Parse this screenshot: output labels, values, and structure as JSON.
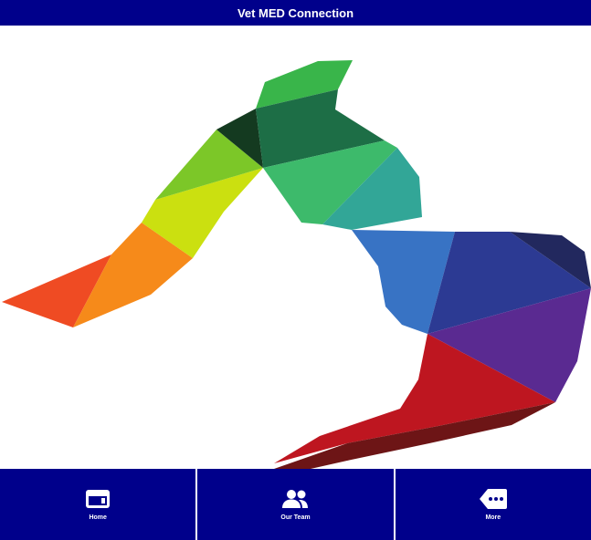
{
  "header": {
    "title": "Vet MED Connection"
  },
  "artwork": {
    "icon": "polygon-animal-silhouette"
  },
  "tabs": [
    {
      "label": "Home",
      "icon": "home-card-icon"
    },
    {
      "label": "Our Team",
      "icon": "people-icon"
    },
    {
      "label": "More",
      "icon": "more-tag-icon"
    }
  ],
  "colors": {
    "header_bg": "#00008b",
    "tab_bg": "#00008b",
    "text": "#ffffff"
  }
}
